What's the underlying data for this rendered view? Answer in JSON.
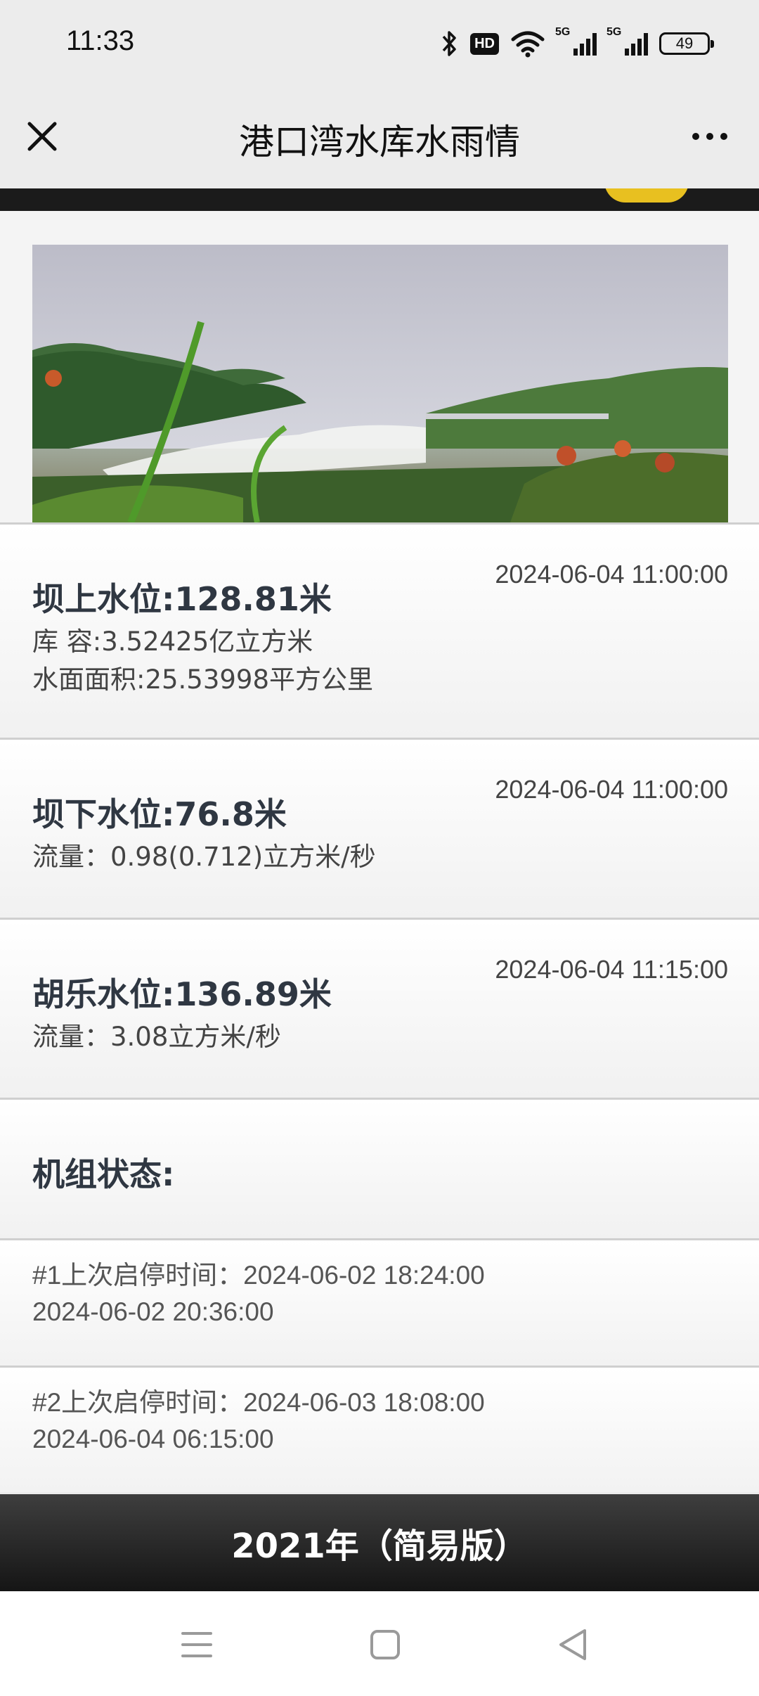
{
  "status_bar": {
    "time": "11:33",
    "hd_label": "HD",
    "signal1_label": "5G",
    "signal2_label": "5G",
    "battery": "49",
    "icons": [
      "bluetooth-icon",
      "hd-icon",
      "wifi-icon",
      "signal-5g-icon",
      "signal-5g-icon",
      "battery-icon"
    ]
  },
  "nav": {
    "title": "港口湾水库水雨情",
    "close_icon": "close-icon",
    "more_icon": "more-icon"
  },
  "banner": {
    "alt": "reservoir spillway photo"
  },
  "upstream": {
    "title": "坝上水位:128.81米",
    "time": "2024-06-04 11:00:00",
    "capacity": "库 容:3.52425亿立方米",
    "area": "水面面积:25.53998平方公里"
  },
  "downstream": {
    "title": "坝下水位:76.8米",
    "time": "2024-06-04 11:00:00",
    "flow": "流量：0.98(0.712)立方米/秒"
  },
  "hule": {
    "title": "胡乐水位:136.89米",
    "time": "2024-06-04 11:15:00",
    "flow": "流量：3.08立方米/秒"
  },
  "units": {
    "title": "机组状态:",
    "unit1_line1": "#1上次启停时间：2024-06-02 18:24:00",
    "unit1_line2": "2024-06-02 20:36:00",
    "unit2_line1": "#2上次启停时间：2024-06-03 18:08:00",
    "unit2_line2": "2024-06-04 06:15:00"
  },
  "footer": {
    "button_label": "2021年（简易版）"
  },
  "system_nav": {
    "icons": [
      "menu-icon",
      "home-icon",
      "back-icon"
    ]
  }
}
